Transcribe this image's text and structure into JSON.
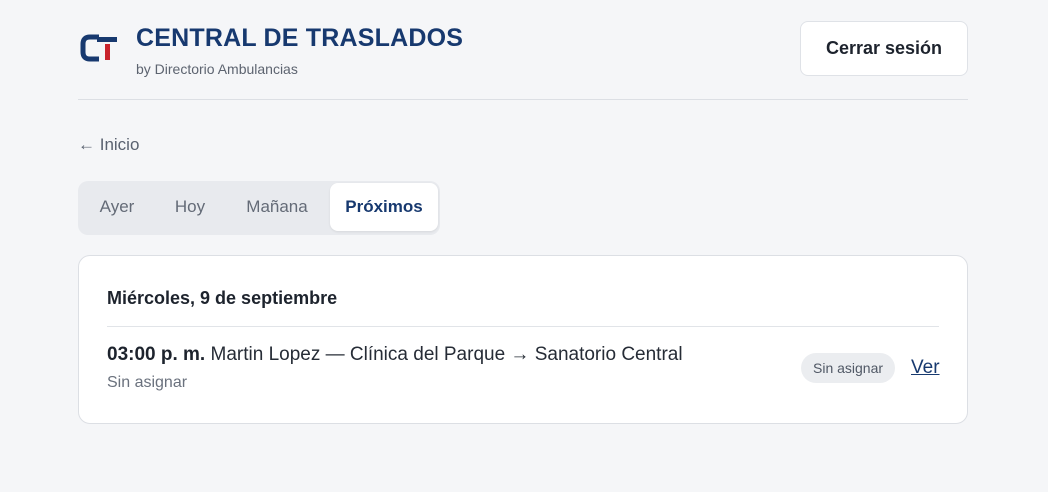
{
  "header": {
    "brand_title": "CENTRAL DE TRASLADOS",
    "brand_subtitle": "by Directorio Ambulancias",
    "logout_label": "Cerrar sesión"
  },
  "nav": {
    "back_label": "← Inicio"
  },
  "tabs": [
    {
      "label": "Ayer",
      "active": false
    },
    {
      "label": "Hoy",
      "active": false
    },
    {
      "label": "Mañana",
      "active": false
    },
    {
      "label": "Próximos",
      "active": true
    }
  ],
  "schedule": {
    "day_title": "Miércoles, 9 de septiembre",
    "trips": [
      {
        "time": "03:00 p. m.",
        "description": "Martin Lopez — Clínica del Parque → Sanatorio Central",
        "status": "Sin asignar",
        "badge": "Sin asignar",
        "action_label": "Ver"
      }
    ]
  },
  "colors": {
    "brand_navy": "#17396f",
    "brand_red": "#c8232c",
    "background": "#f5f6f8"
  }
}
